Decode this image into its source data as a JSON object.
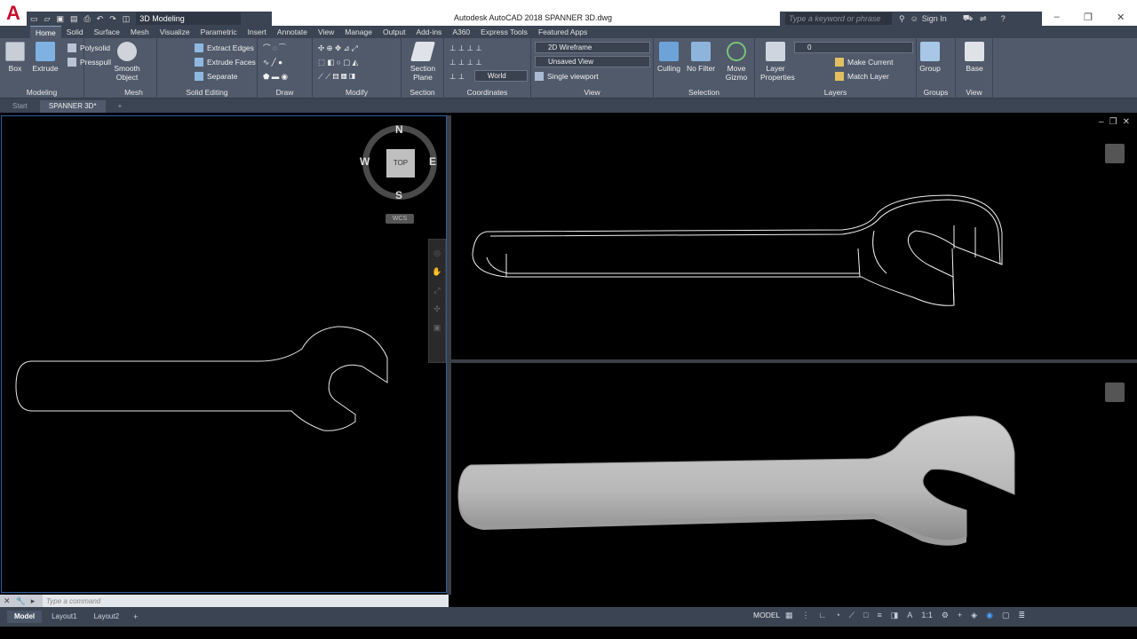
{
  "app": {
    "title": "Autodesk AutoCAD 2018   SPANNER 3D.dwg",
    "logo": "A",
    "workspace": "3D Modeling"
  },
  "search": {
    "placeholder": "Type a keyword or phrase",
    "sign_in": "Sign In"
  },
  "ribbon_tabs": [
    "Home",
    "Solid",
    "Surface",
    "Mesh",
    "Visualize",
    "Parametric",
    "Insert",
    "Annotate",
    "View",
    "Manage",
    "Output",
    "Add-ins",
    "A360",
    "Express Tools",
    "Featured Apps"
  ],
  "ribbon": {
    "modeling": {
      "title": "Modeling",
      "box": "Box",
      "extrude": "Extrude",
      "polysolid": "Polysolid",
      "presspull": "Presspull"
    },
    "mesh": {
      "title": "Mesh",
      "smooth": "Smooth",
      "object": "Object"
    },
    "solid_editing": {
      "title": "Solid Editing",
      "extract_edges": "Extract Edges",
      "extrude_faces": "Extrude Faces",
      "separate": "Separate"
    },
    "draw": {
      "title": "Draw"
    },
    "modify": {
      "title": "Modify"
    },
    "section": {
      "title": "Section",
      "section_plane": "Section",
      "section_plane2": "Plane"
    },
    "coordinates": {
      "title": "Coordinates",
      "world": "World"
    },
    "view": {
      "title": "View",
      "visual_style": "2D Wireframe",
      "named_view": "Unsaved View",
      "viewport": "Single viewport"
    },
    "selection": {
      "title": "Selection",
      "culling": "Culling",
      "no_filter": "No Filter",
      "move": "Move",
      "gizmo": "Gizmo"
    },
    "layers": {
      "title": "Layers",
      "layer": "Layer",
      "properties": "Properties",
      "current_layer": "0",
      "make_current": "Make Current",
      "match_layer": "Match Layer"
    },
    "groups": {
      "title": "Groups",
      "group": "Group"
    },
    "view2": {
      "title": "View",
      "base": "Base"
    }
  },
  "file_tabs": [
    "Start",
    "SPANNER 3D*"
  ],
  "viewcube": {
    "top": "TOP",
    "n": "N",
    "s": "S",
    "e": "E",
    "w": "W",
    "wcs": "WCS"
  },
  "command": {
    "placeholder": "Type a command"
  },
  "layout_tabs": [
    "Model",
    "Layout1",
    "Layout2"
  ],
  "status": {
    "model": "MODEL",
    "scale": "1:1"
  },
  "colors": {
    "ribbon": "#505a6b",
    "tabs": "#3b4453",
    "accent": "#2b5f9e",
    "logo": "#c8102e"
  }
}
